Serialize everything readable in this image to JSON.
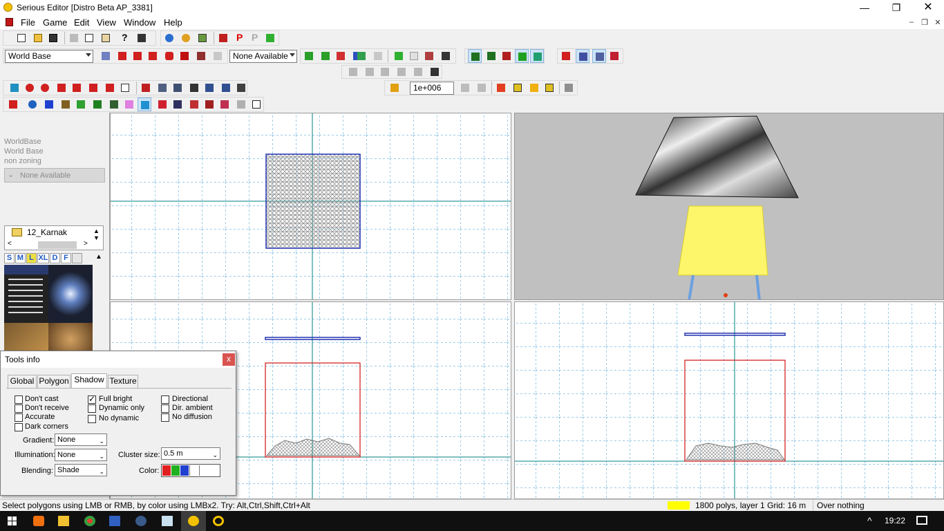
{
  "window": {
    "title": "Serious Editor [Distro Beta AP_3381]"
  },
  "menu": [
    "File",
    "Game",
    "Edit",
    "View",
    "Window",
    "Help"
  ],
  "toolbar": {
    "world_combo": "World Base",
    "none_combo": "None Available",
    "grid_value": "1e+006",
    "p_label": "P"
  },
  "left_panel": {
    "line1": "WorldBase",
    "line2": "World Base",
    "line3": "non zoning",
    "combo": "None Available",
    "folder": "12_Karnak",
    "size_buttons": [
      "S",
      "M",
      "L",
      "XL",
      "D",
      "F"
    ]
  },
  "tools_info": {
    "title": "Tools info",
    "close": "x",
    "tabs": [
      "Global",
      "Polygon",
      "Shadow",
      "Texture"
    ],
    "active_tab": "Shadow",
    "col1": [
      {
        "label": "Don't cast",
        "checked": false
      },
      {
        "label": "Don't receive",
        "checked": false
      },
      {
        "label": "Accurate",
        "checked": false
      },
      {
        "label": "Dark corners",
        "checked": false
      }
    ],
    "col2": [
      {
        "label": "Full bright",
        "checked": true
      },
      {
        "label": "Dynamic only",
        "checked": false
      },
      {
        "label": "No dynamic",
        "checked": false
      }
    ],
    "col3": [
      {
        "label": "Directional",
        "checked": false
      },
      {
        "label": "Dir. ambient",
        "checked": false
      },
      {
        "label": "No diffusion",
        "checked": false
      }
    ],
    "gradient_label": "Gradient:",
    "gradient_value": "None",
    "illumination_label": "Illumination:",
    "illumination_value": "None",
    "blending_label": "Blending:",
    "blending_value": "Shade",
    "cluster_label": "Cluster size:",
    "cluster_value": "0.5 m",
    "color_label": "Color:"
  },
  "status": {
    "hint": "Select polygons using LMB or RMB, by color using LMBx2. Try: Alt,Ctrl,Shift,Ctrl+Alt",
    "stats": "1800 polys, layer 1 Grid: 16 m",
    "over": "Over nothing",
    "indicator_color": "#ffff00"
  },
  "taskbar": {
    "time": "19:22",
    "chevron": "^"
  },
  "colors": {
    "accent": "#1e90ff",
    "grid_major": "#008080",
    "grid_minor": "#0078c8",
    "selection": "#d01010"
  }
}
